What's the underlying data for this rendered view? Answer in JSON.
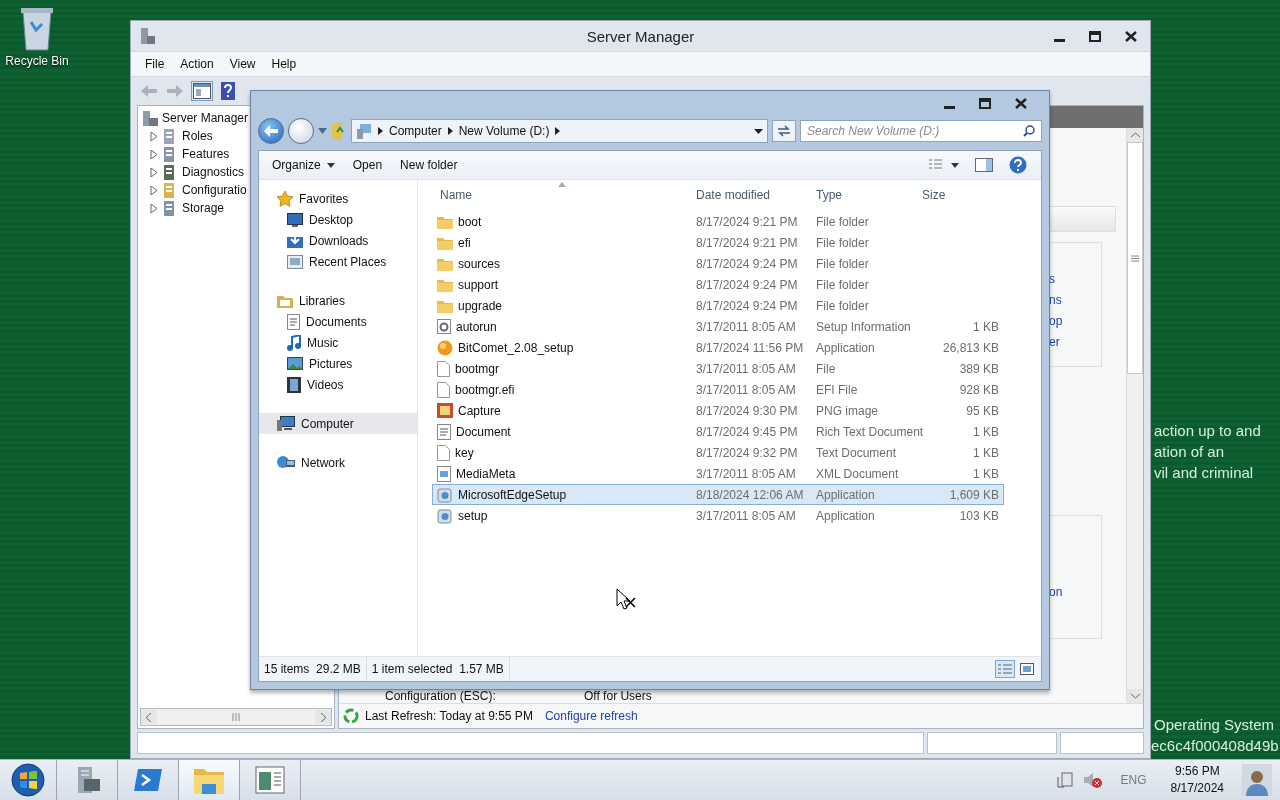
{
  "desktop": {
    "icons": [
      {
        "label": "Recycle Bin"
      }
    ],
    "wallpaper_text": [
      {
        "text": "action up to and"
      },
      {
        "text": "ation of an"
      },
      {
        "text": "vil and criminal"
      }
    ],
    "wallpaper_footer": [
      {
        "text": "Operating System"
      },
      {
        "text": "ec6c4f000408d49b"
      }
    ]
  },
  "server_manager": {
    "title": "Server Manager",
    "menu": [
      "File",
      "Action",
      "View",
      "Help"
    ],
    "tree": {
      "label": "Server Manager",
      "children": [
        {
          "label": "Roles",
          "expanded": false
        },
        {
          "label": "Features",
          "expanded": false
        },
        {
          "label": "Diagnostics",
          "expanded": false
        },
        {
          "label": "Configuratio",
          "expanded": false
        },
        {
          "label": "Storage",
          "expanded": false
        }
      ]
    },
    "right_links": [
      "s",
      "ns",
      "op",
      "er"
    ],
    "lower_link": "on",
    "setting_label": "Configuration (ESC):",
    "setting_value": "Off for Users",
    "last_refresh": "Last Refresh: Today at 9:55 PM",
    "configure_refresh": "Configure refresh"
  },
  "explorer": {
    "breadcrumb": [
      "Computer",
      "New Volume (D:)"
    ],
    "search": {
      "placeholder": "Search New Volume (D:)"
    },
    "toolbar": [
      "Organize",
      "Open",
      "New folder"
    ],
    "nav": [
      {
        "label": "Favorites",
        "kind": "star",
        "selected": false,
        "children": [
          {
            "label": "Desktop",
            "kind": "desktop",
            "selected": false
          },
          {
            "label": "Downloads",
            "kind": "download",
            "selected": false
          },
          {
            "label": "Recent Places",
            "kind": "places",
            "selected": false
          }
        ]
      },
      {
        "label": "Libraries",
        "kind": "library",
        "selected": false,
        "children": [
          {
            "label": "Documents",
            "kind": "document",
            "selected": false
          },
          {
            "label": "Music",
            "kind": "music",
            "selected": false
          },
          {
            "label": "Pictures",
            "kind": "picture",
            "selected": false
          },
          {
            "label": "Videos",
            "kind": "video",
            "selected": false
          }
        ]
      },
      {
        "label": "Computer",
        "kind": "computer",
        "selected": true
      },
      {
        "label": "Network",
        "kind": "network",
        "selected": false
      }
    ],
    "columns": [
      "Name",
      "Date modified",
      "Type",
      "Size"
    ],
    "rows": [
      {
        "name": "boot",
        "date": "8/17/2024 9:21 PM",
        "type": "File folder",
        "kind": "folder",
        "selected": false
      },
      {
        "name": "efi",
        "date": "8/17/2024 9:21 PM",
        "type": "File folder",
        "kind": "folder",
        "selected": false
      },
      {
        "name": "sources",
        "date": "8/17/2024 9:24 PM",
        "type": "File folder",
        "kind": "folder",
        "selected": false
      },
      {
        "name": "support",
        "date": "8/17/2024 9:24 PM",
        "type": "File folder",
        "kind": "folder",
        "selected": false
      },
      {
        "name": "upgrade",
        "date": "8/17/2024 9:24 PM",
        "type": "File folder",
        "kind": "folder",
        "selected": false
      },
      {
        "name": "autorun",
        "date": "3/17/2011 8:05 AM",
        "type": "Setup Information",
        "size": "1 KB",
        "kind": "config",
        "selected": false
      },
      {
        "name": "BitComet_2.08_setup",
        "date": "8/17/2024 11:56 PM",
        "type": "Application",
        "size": "26,813 KB",
        "kind": "app",
        "selected": false
      },
      {
        "name": "bootmgr",
        "date": "3/17/2011 8:05 AM",
        "type": "File",
        "size": "389 KB",
        "kind": "file",
        "selected": false
      },
      {
        "name": "bootmgr.efi",
        "date": "3/17/2011 8:05 AM",
        "type": "EFI File",
        "size": "928 KB",
        "kind": "file",
        "selected": false
      },
      {
        "name": "Capture",
        "date": "8/17/2024 9:30 PM",
        "type": "PNG image",
        "size": "95 KB",
        "kind": "image",
        "selected": false
      },
      {
        "name": "Document",
        "date": "8/17/2024 9:45 PM",
        "type": "Rich Text Document",
        "size": "1 KB",
        "kind": "document",
        "selected": false
      },
      {
        "name": "key",
        "date": "8/17/2024 9:32 PM",
        "type": "Text Document",
        "size": "1 KB",
        "kind": "file",
        "selected": false
      },
      {
        "name": "MediaMeta",
        "date": "3/17/2011 8:05 AM",
        "type": "XML Document",
        "size": "1 KB",
        "kind": "xml",
        "selected": false
      },
      {
        "name": "MicrosoftEdgeSetup",
        "date": "8/18/2024 12:06 AM",
        "type": "Application",
        "size": "1,609 KB",
        "kind": "installer",
        "selected": true
      },
      {
        "name": "setup",
        "date": "3/17/2011 8:05 AM",
        "type": "Application",
        "size": "103 KB",
        "kind": "installer",
        "selected": false
      }
    ],
    "status": [
      "15 items  29.2 MB",
      "1 item selected  1.57 MB"
    ]
  },
  "taskbar": {
    "apps": [
      {
        "kind": "server",
        "selected": false
      },
      {
        "kind": "shell",
        "selected": false
      },
      {
        "kind": "explorer",
        "selected": true
      },
      {
        "kind": "window",
        "selected": false
      }
    ],
    "language": "ENG",
    "time": "9:56 PM",
    "date": "8/17/2024"
  }
}
